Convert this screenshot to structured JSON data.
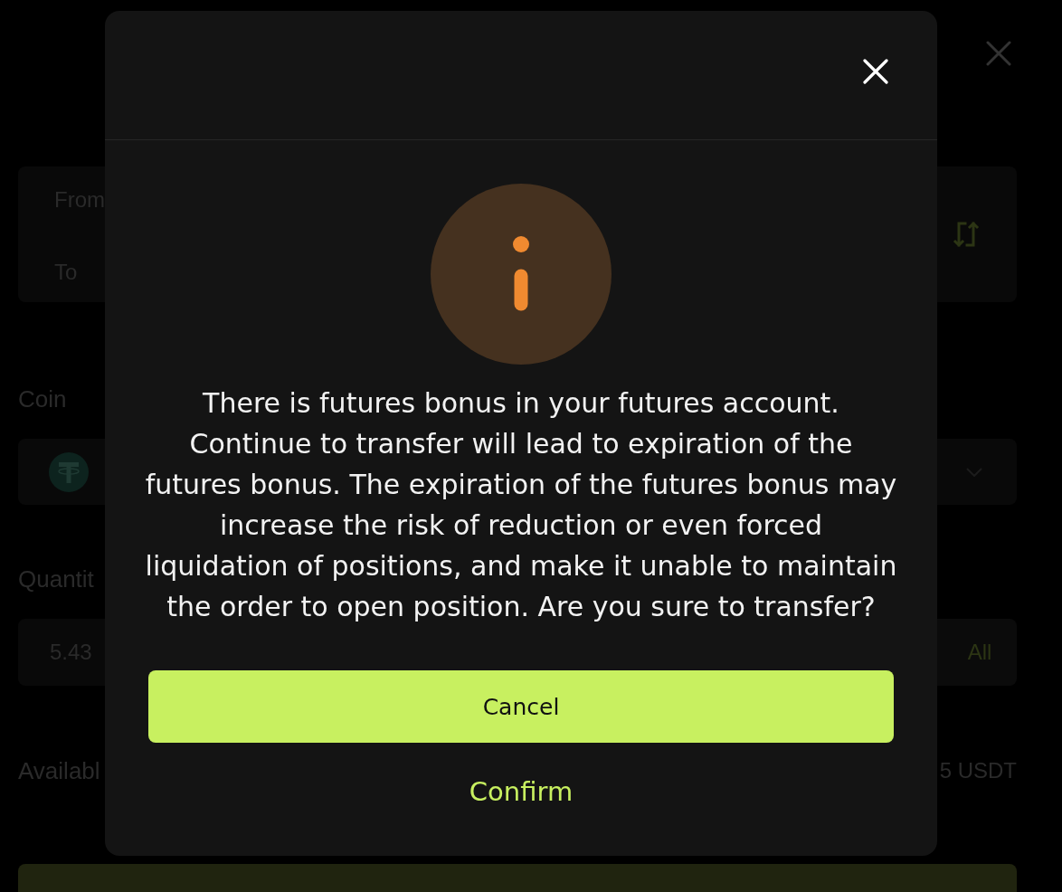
{
  "transfer_form": {
    "from_label": "From",
    "to_label": "To",
    "coin_label": "Coin",
    "quantity_label": "Quantit",
    "quantity_field": {
      "value": "5.43"
    },
    "all_button": "All",
    "available_label": "Availabl",
    "available_value": "5 USDT"
  },
  "dialog": {
    "message": "There is futures bonus in your futures account. Continue to transfer will lead to expiration of the futures bonus. The expiration of the futures bonus may increase the risk of reduction or even forced liquidation of positions, and make it unable to maintain the order to open position. Are you sure to transfer?",
    "buttons": [
      {
        "label": "Cancel",
        "kind": "primary"
      },
      {
        "label": "Confirm",
        "kind": "text"
      }
    ]
  }
}
